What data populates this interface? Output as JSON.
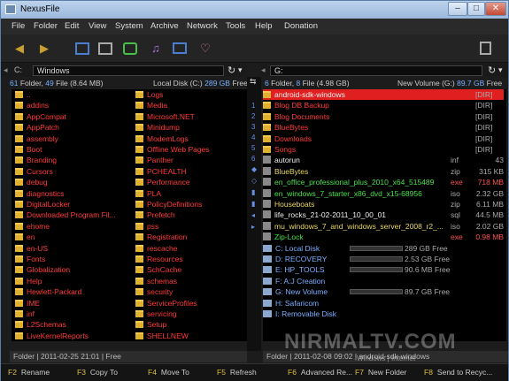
{
  "window": {
    "title": "NexusFile"
  },
  "menu": [
    "File",
    "Folder",
    "Edit",
    "View",
    "System",
    "Archive",
    "Network",
    "Tools",
    "Help",
    "Donation"
  ],
  "left": {
    "drive": "C:",
    "path": "Windows",
    "info": {
      "folders": "61",
      "folders_label": "Folder,",
      "files": "49",
      "files_label": "File",
      "size": "(8.64 MB)",
      "disk": "Local Disk (C:)",
      "free": "289 GB",
      "free_label": "Free"
    },
    "col1": [
      "..",
      "addins",
      "AppCompat",
      "AppPatch",
      "assembly",
      "Boot",
      "Branding",
      "Cursors",
      "debug",
      "diagnostics",
      "DigitalLocker",
      "Downloaded Program Fil...",
      "ehome",
      "en",
      "en-US",
      "Fonts",
      "Globalization",
      "Help",
      "Hewlett-Packard",
      "IME",
      "inf",
      "L2Schemas",
      "LiveKernelReports"
    ],
    "col2": [
      "Logs",
      "Media",
      "Microsoft.NET",
      "Minidump",
      "ModemLogs",
      "Offline Web Pages",
      "Panther",
      "PCHEALTH",
      "Performance",
      "PLA",
      "PolicyDefinitions",
      "Prefetch",
      "pss",
      "Registration",
      "rescache",
      "Resources",
      "SchCache",
      "schemas",
      "security",
      "ServiceProfiles",
      "servicing",
      "Setup",
      "SHELLNEW"
    ],
    "status": "Folder | 2011-02-25 21:01 | Free"
  },
  "right": {
    "drive": "G:",
    "path": "",
    "info": {
      "folders": "6",
      "folders_label": "Folder,",
      "files": "8",
      "files_label": "File",
      "size": "(4.98 GB)",
      "disk": "New Volume (G:)",
      "free": "89.7 GB",
      "free_label": "Free"
    },
    "folders": [
      {
        "name": "android-sdk-windows",
        "tag": "[DIR]"
      },
      {
        "name": "Blog DB Backup",
        "tag": "[DIR]"
      },
      {
        "name": "Blog Documents",
        "tag": "[DIR]"
      },
      {
        "name": "BlueBytes",
        "tag": "[DIR]"
      },
      {
        "name": "Downloads",
        "tag": "[DIR]"
      },
      {
        "name": "Songs",
        "tag": "[DIR]"
      }
    ],
    "files": [
      {
        "name": "autorun",
        "ext": "inf",
        "size": "43"
      },
      {
        "name": "BlueBytes",
        "ext": "zip",
        "size": "315 KB"
      },
      {
        "name": "en_office_professional_plus_2010_x64_515489",
        "ext": "exe",
        "size": "718 MB"
      },
      {
        "name": "en_windows_7_starter_x86_dvd_x15-68956",
        "ext": "iso",
        "size": "2.32 GB"
      },
      {
        "name": "Houseboats",
        "ext": "zip",
        "size": "6.11 MB"
      },
      {
        "name": "life_rocks_21-02-2011_10_00_01",
        "ext": "sql",
        "size": "44.5 MB"
      },
      {
        "name": "mu_windows_7_and_windows_server_2008_r2_...",
        "ext": "iso",
        "size": "2.02 GB"
      },
      {
        "name": "Zip-Lock",
        "ext": "exe",
        "size": "0.98 MB"
      }
    ],
    "drives": [
      {
        "name": "C: Local Disk",
        "free": "289 GB Free"
      },
      {
        "name": "D: RECOVERY",
        "free": "2.53 GB Free"
      },
      {
        "name": "E: HP_TOOLS",
        "free": "90.6 MB Free"
      },
      {
        "name": "F: A:J Creation",
        "free": ""
      },
      {
        "name": "G: New Volume",
        "free": "89.7 GB Free"
      },
      {
        "name": "H: Safaricom",
        "free": ""
      },
      {
        "name": "I:  Removable Disk",
        "free": ""
      }
    ],
    "status": "Folder | 2011-02-08 09:02 | android-sdk-windows"
  },
  "middle": [
    "1",
    "2",
    "3",
    "4",
    "5",
    "6"
  ],
  "fkeys": [
    {
      "key": "F2",
      "label": "Rename"
    },
    {
      "key": "F3",
      "label": "Copy To"
    },
    {
      "key": "F4",
      "label": "Move To"
    },
    {
      "key": "F5",
      "label": "Refresh"
    },
    {
      "key": "F6",
      "label": "Advanced Re..."
    },
    {
      "key": "F7",
      "label": "New Folder"
    },
    {
      "key": "F8",
      "label": "Send to Recyc..."
    }
  ],
  "watermark": {
    "main": "NIRMALTV.COM",
    "sub": "Windows | Internet"
  }
}
